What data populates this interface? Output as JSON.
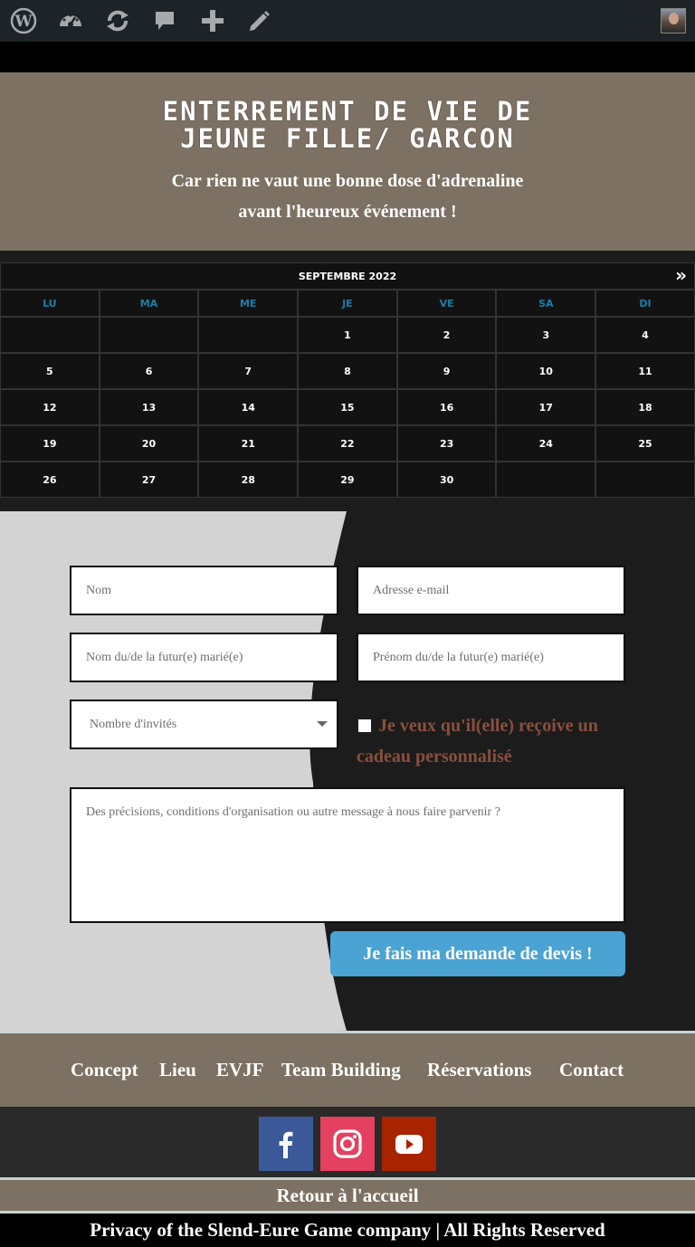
{
  "adminbar": {
    "icons": [
      "wordpress-icon",
      "dashboard-icon",
      "updates-icon",
      "comments-icon",
      "new-content-icon",
      "edit-icon"
    ]
  },
  "hero": {
    "title_line1": "ENTERREMENT DE VIE DE",
    "title_line2": "JEUNE FILLE/ GARCON",
    "subtitle_line1": "Car rien ne vaut une bonne dose d'adrenaline",
    "subtitle_line2": "avant l'heureux événement !"
  },
  "calendar": {
    "month": "SEPTEMBRE 2022",
    "next": "»",
    "days": [
      "LU",
      "MA",
      "ME",
      "JE",
      "VE",
      "SA",
      "DI"
    ],
    "weeks": [
      [
        "",
        "",
        "",
        "1",
        "2",
        "3",
        "4"
      ],
      [
        "5",
        "6",
        "7",
        "8",
        "9",
        "10",
        "11"
      ],
      [
        "12",
        "13",
        "14",
        "15",
        "16",
        "17",
        "18"
      ],
      [
        "19",
        "20",
        "21",
        "22",
        "23",
        "24",
        "25"
      ],
      [
        "26",
        "27",
        "28",
        "29",
        "30",
        "",
        ""
      ]
    ]
  },
  "form": {
    "nom_placeholder": "Nom",
    "email_placeholder": "Adresse e-mail",
    "nom_marie_placeholder": "Nom du/de la futur(e) marié(e)",
    "prenom_marie_placeholder": "Prénom du/de la futur(e) marié(e)",
    "invites_placeholder": "Nombre d'invités",
    "gift_label": "Je veux qu'il(elle) reçoive un cadeau personnalisé",
    "message_placeholder": "Des précisions, conditions d'organisation ou autre message à nous faire parvenir ?",
    "submit_label": "Je fais ma demande de devis !"
  },
  "footer": {
    "nav": [
      "Concept",
      "Lieu",
      "EVJF",
      "Team Building",
      "Réservations",
      "Contact"
    ],
    "social": [
      "facebook-icon",
      "instagram-icon",
      "youtube-icon"
    ],
    "colors": {
      "facebook": "#3b5998",
      "instagram": "#e4405f",
      "youtube": "#a82400"
    },
    "retour": "Retour à l'accueil",
    "privacy": "Privacy of the Slend-Eure Game company  | All Rights Reserved"
  }
}
